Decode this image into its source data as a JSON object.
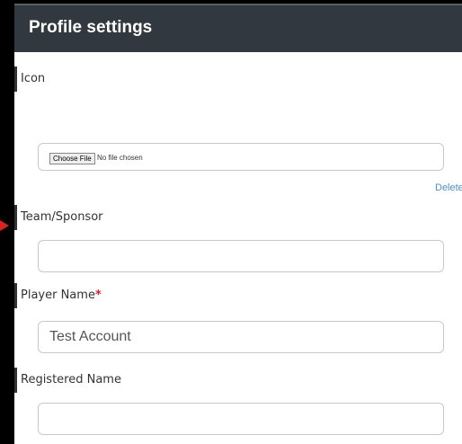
{
  "header": {
    "title": "Profile settings"
  },
  "icon_section": {
    "label": "Icon",
    "choose_file_label": "Choose File",
    "file_status": "No file chosen",
    "delete_label": "Delete"
  },
  "team_sponsor": {
    "label": "Team/Sponsor",
    "value": ""
  },
  "player_name": {
    "label": "Player Name",
    "required_mark": "*",
    "value": "Test Account"
  },
  "registered_name": {
    "label": "Registered Name",
    "value": ""
  },
  "colors": {
    "header_bg": "#32383f",
    "required": "#e02020",
    "link": "#4a90c8"
  }
}
